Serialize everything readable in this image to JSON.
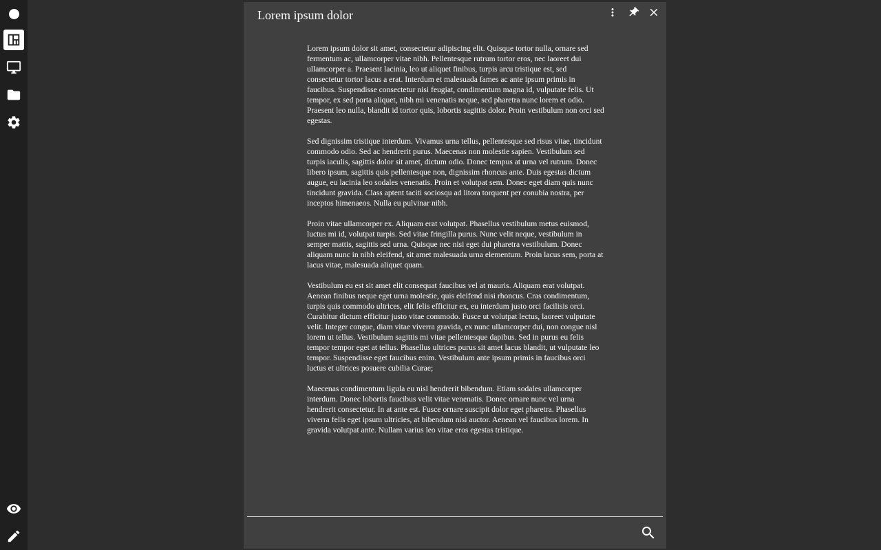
{
  "sidebar": {
    "top_items": [
      {
        "icon": "status-dot-icon"
      },
      {
        "icon": "dashboard-layout-icon",
        "active": true
      },
      {
        "icon": "monitor-icon"
      },
      {
        "icon": "folder-icon"
      },
      {
        "icon": "gear-icon"
      }
    ],
    "bottom_items": [
      {
        "icon": "eye-icon"
      },
      {
        "icon": "pencil-icon"
      }
    ]
  },
  "panel": {
    "title": "Lorem ipsum dolor",
    "actions": [
      "more-vert-icon",
      "pin-icon",
      "close-icon"
    ],
    "paragraphs": [
      "Lorem ipsum dolor sit amet, consectetur adipiscing elit. Quisque tortor nulla, ornare sed fermentum ac, ullamcorper vitae nibh. Pellentesque rutrum tortor eros, nec laoreet dui ullamcorper a. Praesent lacinia, leo ut aliquet finibus, turpis arcu tristique est, sed consectetur tortor lacus a erat. Interdum et malesuada fames ac ante ipsum primis in faucibus. Suspendisse consectetur nisi feugiat, condimentum magna id, vulputate felis. Ut tempor, ex sed porta aliquet, nibh mi venenatis neque, sed pharetra nunc lorem et odio. Praesent leo nulla, blandit id tortor quis, lobortis sagittis dolor. Proin vestibulum non orci sed egestas.",
      "Sed dignissim tristique interdum. Vivamus urna tellus, pellentesque sed risus vitae, tincidunt commodo odio. Sed ac hendrerit purus. Maecenas non molestie sapien. Vestibulum sed turpis iaculis, sagittis dolor sit amet, dictum odio. Donec tempus at urna vel rutrum. Donec libero ipsum, sagittis quis pellentesque non, dignissim rhoncus ante. Duis egestas dictum augue, eu lacinia leo sodales venenatis. Proin et volutpat sem. Donec eget diam quis nunc tincidunt gravida. Class aptent taciti sociosqu ad litora torquent per conubia nostra, per inceptos himenaeos. Nulla eu pulvinar nibh.",
      "Proin vitae ullamcorper ex. Aliquam erat volutpat. Phasellus vestibulum metus euismod, luctus mi id, volutpat turpis. Sed vitae fringilla purus. Nunc velit neque, vestibulum in semper mattis, sagittis sed urna. Quisque nec nisi eget dui pharetra vestibulum. Donec aliquam nunc in nibh eleifend, sit amet malesuada urna elementum. Proin lacus sem, porta at lacus vitae, malesuada aliquet quam.",
      "Vestibulum eu est sit amet elit consequat faucibus vel at mauris. Aliquam erat volutpat. Aenean finibus neque eget urna molestie, quis eleifend nisi rhoncus. Cras condimentum, turpis quis commodo ultrices, elit felis efficitur ex, eu interdum justo orci facilisis orci. Curabitur dictum efficitur justo vitae commodo. Fusce ut volutpat lectus, laoreet vulputate velit. Integer congue, diam vitae viverra gravida, ex nunc ullamcorper dui, non congue nisl lorem ut tellus. Vestibulum sagittis mi vitae pellentesque dapibus. Sed in purus eu felis tempor tempor eget at tellus. Phasellus ultrices purus sit amet lacus blandit, ut vulputate leo tempor. Suspendisse eget faucibus enim. Vestibulum ante ipsum primis in faucibus orci luctus et ultrices posuere cubilia Curae;",
      "Maecenas condimentum ligula eu nisl hendrerit bibendum. Etiam sodales ullamcorper interdum. Donec lobortis faucibus velit vitae venenatis. Donec ornare nunc vel urna hendrerit consectetur. In at ante est. Fusce ornare suscipit dolor eget pharetra. Phasellus viverra felis eget ipsum ultricies, at bibendum nisi auctor. Aenean vel faucibus lorem. In gravida volutpat ante. Nullam varius leo vitae eros egestas tristique."
    ],
    "search": {
      "value": "",
      "placeholder": "",
      "icon": "search-icon"
    }
  },
  "colors": {
    "background": "#2d2d2d",
    "sidebar": "#1f1f1f",
    "panel": "#404040",
    "text": "#ffffff"
  }
}
